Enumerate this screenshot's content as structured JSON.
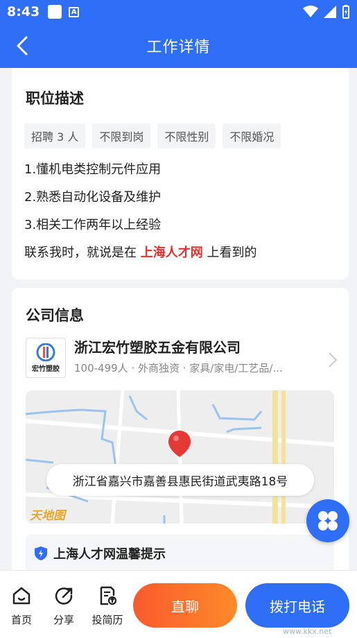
{
  "status_bar": {
    "time": "8:43",
    "app_icon_letter": "A"
  },
  "header": {
    "title": "工作详情"
  },
  "job_description": {
    "heading": "职位描述",
    "tags": [
      "招聘 3 人",
      "不限到岗",
      "不限性别",
      "不限婚况"
    ],
    "lines": [
      "1.懂机电类控制元件应用",
      "2.熟悉自动化设备及维护",
      "3.相关工作两年以上经验"
    ],
    "contact_prefix": "联系我时，就说是在",
    "contact_site": "上海人才网",
    "contact_suffix": "上看到的"
  },
  "company": {
    "heading": "公司信息",
    "logo_text": "宏竹塑胶",
    "name": "浙江宏竹塑胶五金有限公司",
    "meta": "100-499人 · 外商独资 · 家具/家电/工艺品/...",
    "address": "浙江省嘉兴市嘉善县惠民街道武夷路18号",
    "map_brand": "天地图",
    "tip_title": "上海人才网温馨提示"
  },
  "bottom_bar": {
    "home_label": "首页",
    "share_label": "分享",
    "resume_label": "投简历",
    "chat_label": "直聊",
    "call_label": "拨打电话"
  },
  "watermark": "www.kkx.net",
  "colors": {
    "primary": "#2f6ef6",
    "highlight": "#e8302b",
    "chat_gradient_start": "#fb5a2d",
    "chat_gradient_end": "#fd8a2a"
  }
}
